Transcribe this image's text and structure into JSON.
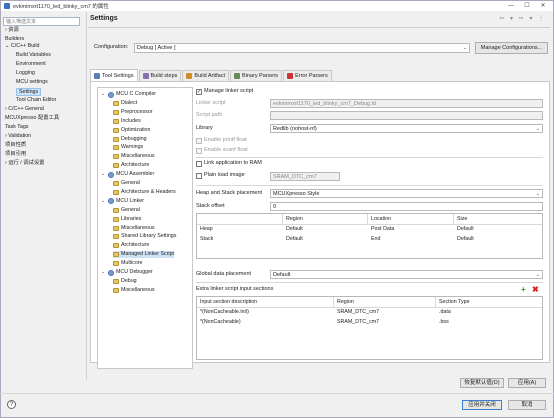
{
  "window": {
    "title": "evkmimxrt1170_led_blinky_cm7 的属性",
    "minimize": "—",
    "maximize": "☐",
    "close": "✕"
  },
  "filter": {
    "placeholder": "输入筛选文本"
  },
  "left_tree": [
    "资源",
    "Builders",
    "C/C++ Build",
    "Build Variables",
    "Environment",
    "Logging",
    "MCU settings",
    "Settings",
    "Tool Chain Editor",
    "C/C++ General",
    "MCUXpresso 配置工具",
    "Task Tags",
    "Validation",
    "项目性质",
    "项目引用",
    "运行 / 调试设置"
  ],
  "left_tree_selected": "Settings",
  "header": {
    "title": "Settings",
    "nav": "⇦ ▾ ⇨ ▾ ⋮"
  },
  "config": {
    "label": "Configuration:",
    "value": "Debug  [ Active ]",
    "manage": "Manage Configurations..."
  },
  "tabs": [
    {
      "label": "Tool Settings",
      "icon": "tool-settings-icon",
      "color": "#5a7fb8"
    },
    {
      "label": "Build steps",
      "icon": "build-steps-icon",
      "color": "#8a6fb0"
    },
    {
      "label": "Build Artifact",
      "icon": "build-artifact-icon",
      "color": "#d28a2a"
    },
    {
      "label": "Binary Parsers",
      "icon": "binary-parsers-icon",
      "color": "#6a8a5a"
    },
    {
      "label": "Error Parsers",
      "icon": "error-parsers-icon",
      "color": "#cc3333"
    }
  ],
  "tool_tree": [
    {
      "label": "MCU C Compiler",
      "level": 0,
      "kind": "gear",
      "exp": "⌄"
    },
    {
      "label": "Dialect",
      "level": 1,
      "kind": "fold"
    },
    {
      "label": "Preprocessor",
      "level": 1,
      "kind": "fold"
    },
    {
      "label": "Includes",
      "level": 1,
      "kind": "fold"
    },
    {
      "label": "Optimization",
      "level": 1,
      "kind": "fold"
    },
    {
      "label": "Debugging",
      "level": 1,
      "kind": "fold"
    },
    {
      "label": "Warnings",
      "level": 1,
      "kind": "fold"
    },
    {
      "label": "Miscellaneous",
      "level": 1,
      "kind": "fold"
    },
    {
      "label": "Architecture",
      "level": 1,
      "kind": "fold"
    },
    {
      "label": "MCU Assembler",
      "level": 0,
      "kind": "gear",
      "exp": "⌄"
    },
    {
      "label": "General",
      "level": 1,
      "kind": "fold"
    },
    {
      "label": "Architecture & Headers",
      "level": 1,
      "kind": "fold"
    },
    {
      "label": "MCU Linker",
      "level": 0,
      "kind": "gear",
      "exp": "⌄"
    },
    {
      "label": "General",
      "level": 1,
      "kind": "fold"
    },
    {
      "label": "Libraries",
      "level": 1,
      "kind": "fold"
    },
    {
      "label": "Miscellaneous",
      "level": 1,
      "kind": "fold"
    },
    {
      "label": "Shared Library Settings",
      "level": 1,
      "kind": "fold"
    },
    {
      "label": "Architecture",
      "level": 1,
      "kind": "fold"
    },
    {
      "label": "Managed Linker Script",
      "level": 1,
      "kind": "fold",
      "sel": true
    },
    {
      "label": "Multicore",
      "level": 1,
      "kind": "fold"
    },
    {
      "label": "MCU Debugger",
      "level": 0,
      "kind": "gear",
      "exp": "⌄"
    },
    {
      "label": "Debug",
      "level": 1,
      "kind": "fold"
    },
    {
      "label": "Miscellaneous",
      "level": 1,
      "kind": "fold"
    }
  ],
  "linker": {
    "manage_linker_script": "Manage linker script",
    "linker_script_label": "Linker script",
    "linker_script_value": "evkmimxrt1170_led_blinky_cm7_Debug.ld",
    "script_path_label": "Script path",
    "library_label": "Library",
    "library_value": "Redlib (nohost-nf)",
    "printf_float": "Enable printf float",
    "scanf_float": "Enable scanf float",
    "link_to_ram": "Link application to RAM",
    "plain_load_image": "Plain load image",
    "plain_load_value": "SRAM_DTC_cm7",
    "heap_stack_label": "Heap and Stack placement",
    "heap_stack_value": "MCUXpresso Style",
    "stack_offset_label": "Stack offset",
    "stack_offset_value": "0",
    "hs_table": {
      "headers": [
        "",
        "Region",
        "Location",
        "Size"
      ],
      "rows": [
        [
          "Heap",
          "Default",
          "Post Data",
          "Default"
        ],
        [
          "Stack",
          "Default",
          "End",
          "Default"
        ]
      ]
    },
    "global_placement_label": "Global data placement",
    "global_placement_value": "Default",
    "extra_sections_label": "Extra linker script input sections",
    "sections_table": {
      "headers": [
        "Input section description",
        "Region",
        "Section Type"
      ],
      "rows": [
        [
          "*(NonCacheable.init)",
          "SRAM_DTC_cm7",
          ".data"
        ],
        [
          "*(NonCacheable)",
          "SRAM_DTC_cm7",
          ".bss"
        ]
      ]
    }
  },
  "buttons": {
    "restore": "恢复默认值(D)",
    "apply": "应用(A)",
    "apply_close": "应用并关闭",
    "cancel": "取消",
    "help": "?"
  }
}
